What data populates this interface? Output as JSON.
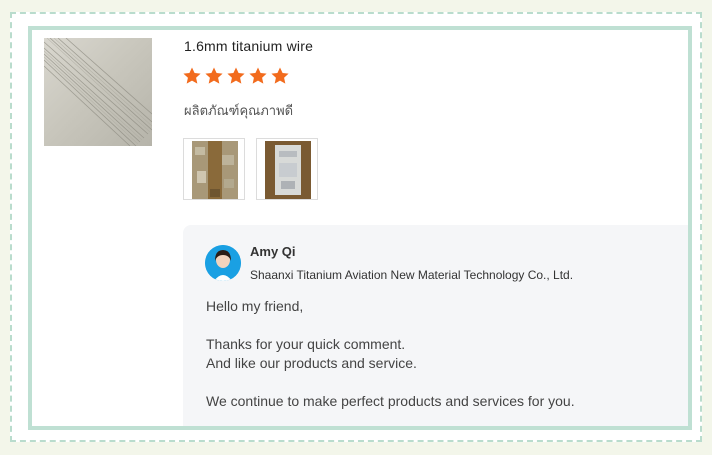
{
  "product": {
    "title": "1.6mm titanium wire",
    "rating": 5,
    "star_color": "#f26b1d",
    "review_text": "ผลิตภัณฑ์คุณภาพดี",
    "image_icon": "titanium-wire-photo",
    "thumbnails": [
      "review-photo-1",
      "review-photo-2"
    ]
  },
  "reply": {
    "seller_name": "Amy Qi",
    "company": "Shaanxi Titanium Aviation New Material Technology Co., Ltd.",
    "lines": [
      "Hello my friend,",
      "Thanks for your quick comment.",
      "And like our products and service.",
      "We continue to make perfect products and services for you."
    ]
  },
  "colors": {
    "frame_border": "#bfe0d3",
    "background": "#f3f6ea",
    "reply_bg": "#f5f6f8",
    "avatar_bg": "#1aa0e3"
  }
}
